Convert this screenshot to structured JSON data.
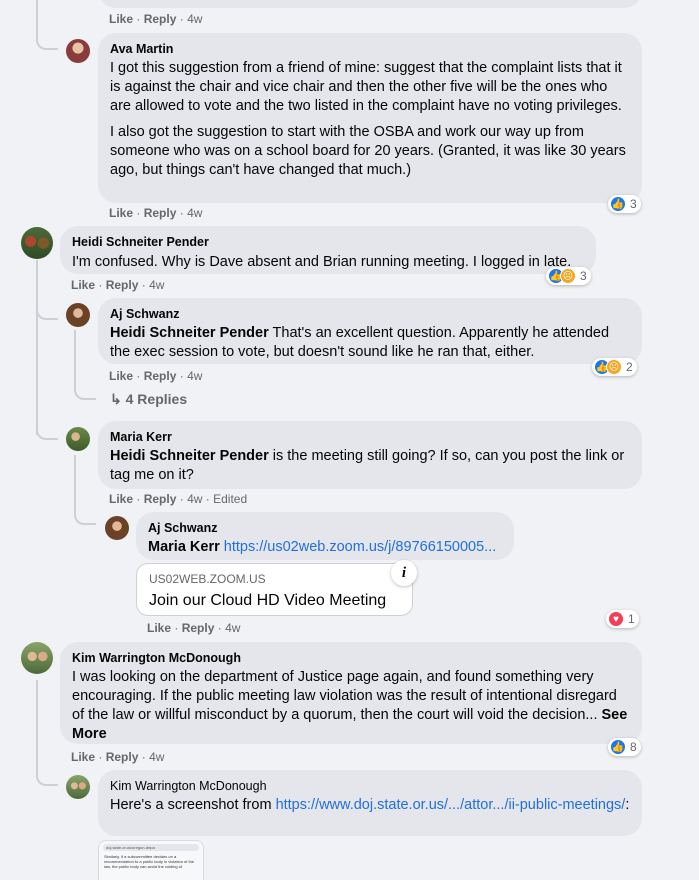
{
  "colors": {
    "link": "#216fdb",
    "bubble": "#e4e6eb",
    "like": "#1877f2",
    "angry": "#f5a623",
    "love": "#f33e58"
  },
  "actions": {
    "like": "Like",
    "reply": "Reply",
    "age": "4w",
    "edited": "Edited",
    "sep": "·"
  },
  "c0": {},
  "c1": {
    "name": "Ava Martin",
    "p1": "I got this suggestion from a friend of mine: suggest that the complaint lists that it is against the chair and vice chair and then the other five will be the ones who are allowed to vote and the two listed in the complaint have no voting privileges.",
    "p2": "I also got the suggestion to start with the OSBA and work our way up from someone who was on a school board for 20 years. (Granted, it was like 30 years ago, but things can't have changed that much.)",
    "reactions": "3"
  },
  "c2": {
    "name": "Heidi Schneiter Pender",
    "text": "I'm confused. Why is Dave absent and Brian running meeting. I logged in late.",
    "reactions": "3"
  },
  "c3": {
    "name": "Aj Schwanz",
    "mention": "Heidi Schneiter Pender",
    "text": " That's an excellent question. Apparently he attended the exec session to vote, but doesn't sound like he ran that, either.",
    "reactions": "2",
    "replies": "4 Replies"
  },
  "c4": {
    "name": "Maria Kerr",
    "mention": "Heidi Schneiter Pender",
    "text": " is the meeting still going? If so, can you post the link or tag me on it?"
  },
  "c5": {
    "name": "Aj Schwanz",
    "mention": "Maria Kerr",
    "link": "https://us02web.zoom.us/j/89766150005...",
    "card_domain": "US02WEB.ZOOM.US",
    "card_title": "Join our Cloud HD Video Meeting",
    "info": "i",
    "reactions": "1"
  },
  "c6": {
    "name": "Kim Warrington McDonough",
    "text": "I was looking on the department of Justice page again, and found something very encouraging. If the public meeting law violation was the result of intentional disregard of the law or willful misconduct by a quorum, then the court will void the decision... ",
    "see_more": "See More",
    "reactions": "8"
  },
  "c7": {
    "name": "Kim Warrington McDonough",
    "text": "Here's a screenshot from ",
    "link": "https://www.doj.state.or.us/.../attor.../ii-public-meetings/",
    "link_tail": ":",
    "thumb_url": "doj.state.or.us/oregon-depa",
    "thumb_text": "Similarly, if a subcommittee decides on a recommendation to a public body in violation of the law, the public body can avoid the voiding of"
  }
}
